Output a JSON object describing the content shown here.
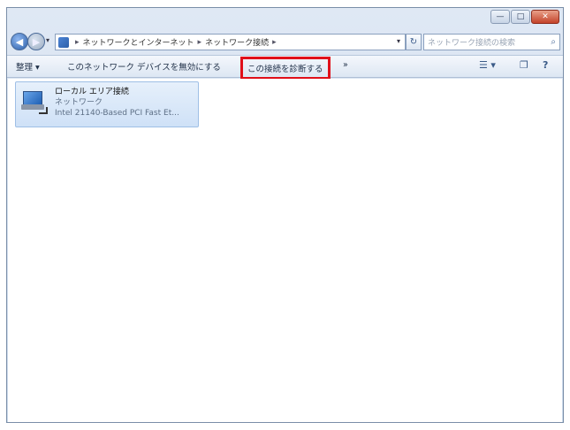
{
  "window": {
    "caption_buttons": {
      "minimize": "—",
      "maximize": "□",
      "close": "✕"
    }
  },
  "address": {
    "icon": "network-folder-icon",
    "back_glyph": "◀",
    "forward_glyph": "▶",
    "dropdown_glyph": "▾",
    "breadcrumb_sep": "▸",
    "breadcrumbs": [
      "ネットワークとインターネット",
      "ネットワーク接続"
    ],
    "refresh_glyph": "↻",
    "search_placeholder": "ネットワーク接続の検索",
    "search_glyph": "⌕"
  },
  "toolbar": {
    "organize": "整理 ▾",
    "disable_device": "このネットワーク デバイスを無効にする",
    "diagnose": "この接続を診断する",
    "more": "»",
    "view_glyph": "☰ ▾",
    "preview_glyph": "❐",
    "help_glyph": "?"
  },
  "connection": {
    "name": "ローカル エリア接続",
    "status": "ネットワーク",
    "device": "Intel 21140-Based PCI Fast Et..."
  },
  "colors": {
    "highlight_border": "#e0101a"
  }
}
